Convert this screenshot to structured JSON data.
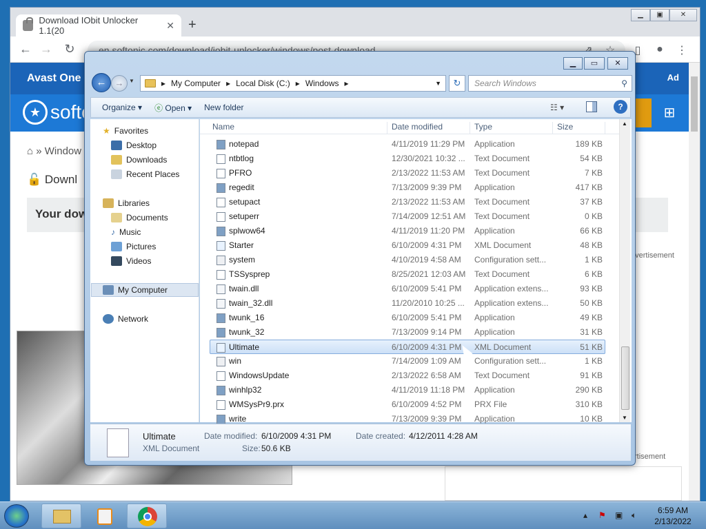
{
  "browser": {
    "tab_title": "Download IObit Unlocker 1.1(20",
    "url": "en.softonic.com/download/iobit-unlocker/windows/post-download"
  },
  "page": {
    "avast_text": "Avast One -",
    "ad_label": "Ad",
    "logo_text": "softo",
    "breadcrumb": "Window",
    "download_title": "Downl",
    "your_download": "Your dow",
    "advertisement": "dvertisement",
    "advertisement2": "rtisement"
  },
  "explorer": {
    "path": [
      "My Computer",
      "Local Disk (C:)",
      "Windows"
    ],
    "search_placeholder": "Search Windows",
    "toolbar": {
      "organize": "Organize",
      "open": "Open",
      "new_folder": "New folder"
    },
    "nav": {
      "favorites": "Favorites",
      "favorites_items": [
        "Desktop",
        "Downloads",
        "Recent Places"
      ],
      "libraries": "Libraries",
      "libraries_items": [
        "Documents",
        "Music",
        "Pictures",
        "Videos"
      ],
      "computer": "My Computer",
      "network": "Network"
    },
    "columns": {
      "name": "Name",
      "date": "Date modified",
      "type": "Type",
      "size": "Size"
    },
    "files": [
      {
        "name": "notepad",
        "date": "4/11/2019 11:29 PM",
        "type": "Application",
        "size": "189 KB"
      },
      {
        "name": "ntbtlog",
        "date": "12/30/2021 10:32 ...",
        "type": "Text Document",
        "size": "54 KB"
      },
      {
        "name": "PFRO",
        "date": "2/13/2022 11:53 AM",
        "type": "Text Document",
        "size": "7 KB"
      },
      {
        "name": "regedit",
        "date": "7/13/2009 9:39 PM",
        "type": "Application",
        "size": "417 KB"
      },
      {
        "name": "setupact",
        "date": "2/13/2022 11:53 AM",
        "type": "Text Document",
        "size": "37 KB"
      },
      {
        "name": "setuperr",
        "date": "7/14/2009 12:51 AM",
        "type": "Text Document",
        "size": "0 KB"
      },
      {
        "name": "splwow64",
        "date": "4/11/2019 11:20 PM",
        "type": "Application",
        "size": "66 KB"
      },
      {
        "name": "Starter",
        "date": "6/10/2009 4:31 PM",
        "type": "XML Document",
        "size": "48 KB"
      },
      {
        "name": "system",
        "date": "4/10/2019 4:58 AM",
        "type": "Configuration sett...",
        "size": "1 KB"
      },
      {
        "name": "TSSysprep",
        "date": "8/25/2021 12:03 AM",
        "type": "Text Document",
        "size": "6 KB"
      },
      {
        "name": "twain.dll",
        "date": "6/10/2009 5:41 PM",
        "type": "Application extens...",
        "size": "93 KB"
      },
      {
        "name": "twain_32.dll",
        "date": "11/20/2010 10:25 ...",
        "type": "Application extens...",
        "size": "50 KB"
      },
      {
        "name": "twunk_16",
        "date": "6/10/2009 5:41 PM",
        "type": "Application",
        "size": "49 KB"
      },
      {
        "name": "twunk_32",
        "date": "7/13/2009 9:14 PM",
        "type": "Application",
        "size": "31 KB"
      },
      {
        "name": "Ultimate",
        "date": "6/10/2009 4:31 PM",
        "type": "XML Document",
        "size": "51 KB",
        "selected": true
      },
      {
        "name": "win",
        "date": "7/14/2009 1:09 AM",
        "type": "Configuration sett...",
        "size": "1 KB"
      },
      {
        "name": "WindowsUpdate",
        "date": "2/13/2022 6:58 AM",
        "type": "Text Document",
        "size": "91 KB"
      },
      {
        "name": "winhlp32",
        "date": "4/11/2019 11:18 PM",
        "type": "Application",
        "size": "290 KB"
      },
      {
        "name": "WMSysPr9.prx",
        "date": "6/10/2009 4:52 PM",
        "type": "PRX File",
        "size": "310 KB"
      },
      {
        "name": "write",
        "date": "7/13/2009 9:39 PM",
        "type": "Application",
        "size": "10 KB"
      }
    ],
    "details": {
      "name": "Ultimate",
      "type": "XML Document",
      "modified_label": "Date modified:",
      "modified": "6/10/2009 4:31 PM",
      "created_label": "Date created:",
      "created": "4/12/2011 4:28 AM",
      "size_label": "Size:",
      "size": "50.6 KB"
    }
  },
  "taskbar": {
    "time": "6:59 AM",
    "date": "2/13/2022"
  }
}
